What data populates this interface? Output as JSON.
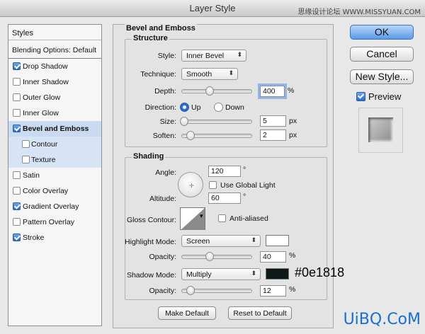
{
  "window": {
    "title": "Layer Style",
    "watermark_top": "思缘设计论坛 WWW.MISSYUAN.COM"
  },
  "styles_panel": {
    "header": "Styles",
    "blending_options": "Blending Options: Default",
    "items": [
      {
        "label": "Drop Shadow",
        "checked": true
      },
      {
        "label": "Inner Shadow",
        "checked": false
      },
      {
        "label": "Outer Glow",
        "checked": false
      },
      {
        "label": "Inner Glow",
        "checked": false
      },
      {
        "label": "Bevel and Emboss",
        "checked": true,
        "selected": true
      },
      {
        "label": "Contour",
        "checked": false,
        "sub": true
      },
      {
        "label": "Texture",
        "checked": false,
        "sub": true
      },
      {
        "label": "Satin",
        "checked": false
      },
      {
        "label": "Color Overlay",
        "checked": false
      },
      {
        "label": "Gradient Overlay",
        "checked": true
      },
      {
        "label": "Pattern Overlay",
        "checked": false
      },
      {
        "label": "Stroke",
        "checked": true
      }
    ]
  },
  "bevel": {
    "title": "Bevel and Emboss",
    "structure": {
      "title": "Structure",
      "style_label": "Style:",
      "style_value": "Inner Bevel",
      "technique_label": "Technique:",
      "technique_value": "Smooth",
      "depth_label": "Depth:",
      "depth_value": "400",
      "depth_unit": "%",
      "depth_slider": 0.4,
      "direction_label": "Direction:",
      "dir_up": "Up",
      "dir_down": "Down",
      "size_label": "Size:",
      "size_value": "5",
      "size_unit": "px",
      "size_slider": 0.03,
      "soften_label": "Soften:",
      "soften_value": "2",
      "soften_unit": "px",
      "soften_slider": 0.12
    },
    "shading": {
      "title": "Shading",
      "angle_label": "Angle:",
      "angle_value": "120",
      "angle_unit": "°",
      "global_light": "Use Global Light",
      "altitude_label": "Altitude:",
      "altitude_value": "60",
      "altitude_unit": "°",
      "gloss_label": "Gloss Contour:",
      "anti_aliased": "Anti-aliased",
      "highlight_label": "Highlight Mode:",
      "highlight_value": "Screen",
      "highlight_color": "#ffffff",
      "hl_opacity_label": "Opacity:",
      "hl_opacity_value": "40",
      "hl_opacity_unit": "%",
      "hl_opacity_slider": 0.4,
      "shadow_label": "Shadow Mode:",
      "shadow_value": "Multiply",
      "shadow_color": "#0e1818",
      "shadow_color_label": "#0e1818",
      "sh_opacity_label": "Opacity:",
      "sh_opacity_value": "12",
      "sh_opacity_unit": "%",
      "sh_opacity_slider": 0.12
    },
    "make_default": "Make Default",
    "reset_default": "Reset to Default"
  },
  "actions": {
    "ok": "OK",
    "cancel": "Cancel",
    "new_style": "New Style...",
    "preview": "Preview"
  },
  "watermark_bottom": "UiBQ.CoM"
}
